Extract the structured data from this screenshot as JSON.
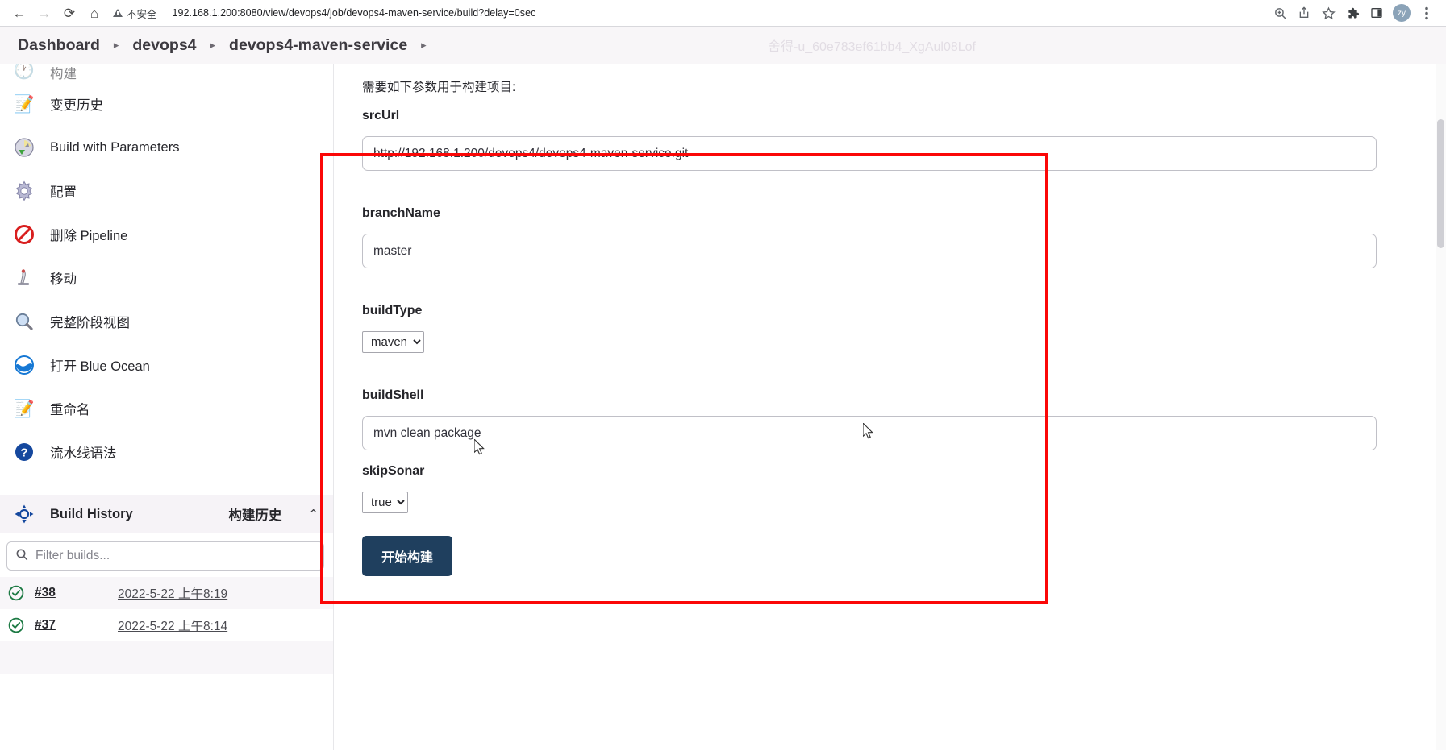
{
  "browser": {
    "back_icon": "back-arrow-icon",
    "forward_icon": "forward-arrow-icon",
    "reload_icon": "reload-icon",
    "home_icon": "home-icon",
    "security_label": "不安全",
    "url": "192.168.1.200:8080/view/devops4/job/devops4-maven-service/build?delay=0sec",
    "toolbar_icons": [
      "zoom-icon",
      "share-icon",
      "bookmark-star-icon",
      "extensions-puzzle-icon",
      "side-panel-icon"
    ],
    "avatar_text": "zy",
    "menu_icon": "three-dot-menu-icon"
  },
  "header": {
    "breadcrumbs": [
      "Dashboard",
      "devops4",
      "devops4-maven-service"
    ],
    "separator": "▸",
    "watermark": "舍得-u_60e783ef61bb4_XgAul08Lof"
  },
  "sidebar": {
    "clipped_item": {
      "label": "构建",
      "icon": "clock-icon"
    },
    "items": [
      {
        "label": "变更历史",
        "icon": "notepad-pencil-icon"
      },
      {
        "label": "Build with Parameters",
        "icon": "build-params-icon"
      },
      {
        "label": "配置",
        "icon": "gear-icon"
      },
      {
        "label": "删除 Pipeline",
        "icon": "delete-forbidden-icon"
      },
      {
        "label": "移动",
        "icon": "move-icon"
      },
      {
        "label": "完整阶段视图",
        "icon": "magnifier-icon"
      },
      {
        "label": "打开 Blue Ocean",
        "icon": "blue-ocean-icon"
      },
      {
        "label": "重命名",
        "icon": "notepad-pencil-icon"
      },
      {
        "label": "流水线语法",
        "icon": "question-help-icon"
      }
    ],
    "build_history": {
      "icon": "build-history-icon",
      "title": "Build History",
      "link_label": "构建历史",
      "collapse_icon": "chevron-up-icon",
      "filter_placeholder": "Filter builds...",
      "search_icon": "search-icon",
      "builds": [
        {
          "status_icon": "success-check-icon",
          "number": "#38",
          "date": "2022-5-22 上午8:19"
        },
        {
          "status_icon": "success-check-icon",
          "number": "#37",
          "date": "2022-5-22 上午8:14"
        }
      ]
    }
  },
  "main": {
    "intro_text": "需要如下参数用于构建项目:",
    "parameters": [
      {
        "name": "srcUrl",
        "type": "text",
        "value": "http://192.168.1.200/devops4/devops4-maven-service.git"
      },
      {
        "name": "branchName",
        "type": "text",
        "value": "master"
      },
      {
        "name": "buildType",
        "type": "select",
        "value": "maven",
        "options": [
          "maven"
        ]
      },
      {
        "name": "buildShell",
        "type": "text",
        "value": "mvn clean package"
      },
      {
        "name": "skipSonar",
        "type": "select",
        "value": "true",
        "options": [
          "true",
          "false"
        ]
      }
    ],
    "submit_label": "开始构建"
  },
  "annotation": {
    "color": "#fb0707"
  }
}
